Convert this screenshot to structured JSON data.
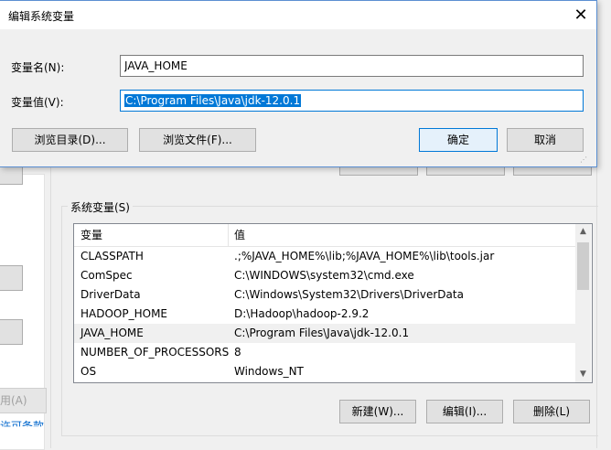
{
  "dialog": {
    "title": "编辑系统变量",
    "close_glyph": "✕",
    "name_label": "变量名(N):",
    "name_value": "JAVA_HOME",
    "value_label": "变量值(V):",
    "value_value": "C:\\Program Files\\Java\\jdk-12.0.1",
    "browse_dir_label": "浏览目录(D)...",
    "browse_file_label": "浏览文件(F)...",
    "ok_label": "确定",
    "cancel_label": "取消"
  },
  "background_window": {
    "left_disabled_button_label": "用(A)",
    "left_link_text": "许可条款",
    "system_vars": {
      "group_label": "系统变量(S)",
      "columns": [
        "变量",
        "值"
      ],
      "rows": [
        {
          "name": "CLASSPATH",
          "value": ".;%JAVA_HOME%\\lib;%JAVA_HOME%\\lib\\tools.jar"
        },
        {
          "name": "ComSpec",
          "value": "C:\\WINDOWS\\system32\\cmd.exe"
        },
        {
          "name": "DriverData",
          "value": "C:\\Windows\\System32\\Drivers\\DriverData"
        },
        {
          "name": "HADOOP_HOME",
          "value": "D:\\Hadoop\\hadoop-2.9.2"
        },
        {
          "name": "JAVA_HOME",
          "value": "C:\\Program Files\\Java\\jdk-12.0.1"
        },
        {
          "name": "NUMBER_OF_PROCESSORS",
          "value": "8"
        },
        {
          "name": "OS",
          "value": "Windows_NT"
        }
      ],
      "selected_row": 4,
      "buttons": {
        "new_label": "新建(W)...",
        "edit_label": "编辑(I)...",
        "delete_label": "删除(L)"
      }
    }
  },
  "colors": {
    "accent": "#0078d7",
    "selection_text": "#ffffff",
    "link": "#0066cc",
    "row_hover": "#f0f0f0"
  },
  "icons": {
    "close": "close-icon",
    "scroll_up": "chevron-up-icon",
    "scroll_down": "chevron-down-icon",
    "resize": "resize-grip-icon"
  }
}
